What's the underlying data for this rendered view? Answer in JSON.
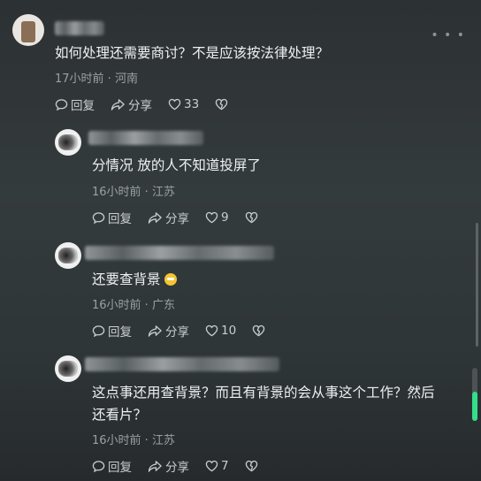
{
  "main_comment": {
    "text": "如何处理还需要商讨？不是应该按法律处理？",
    "meta": "17小时前 · 河南",
    "reply_label": "回复",
    "share_label": "分享",
    "likes": "33"
  },
  "replies": [
    {
      "text": "分情况 放的人不知道投屏了",
      "meta": "16小时前 · 江苏",
      "reply_label": "回复",
      "share_label": "分享",
      "likes": "9"
    },
    {
      "text": "还要查背景",
      "emoji": "grinning-emoji",
      "meta": "16小时前 · 广东",
      "reply_label": "回复",
      "share_label": "分享",
      "likes": "10"
    },
    {
      "text_line1": "这点事还用查背景？而且有背景的会从事这个工作？然后",
      "text_line2": "还看片？",
      "meta": "16小时前 · 江苏",
      "reply_label": "回复",
      "share_label": "分享",
      "likes": "7"
    }
  ],
  "icons": {
    "more": "more-icon",
    "reply": "comment-bubble-icon",
    "share": "share-arrow-icon",
    "like": "heart-icon",
    "dislike": "broken-heart-icon"
  },
  "colors": {
    "accent_progress": "#33e08a"
  },
  "scroll_progress_fraction": 0.55
}
